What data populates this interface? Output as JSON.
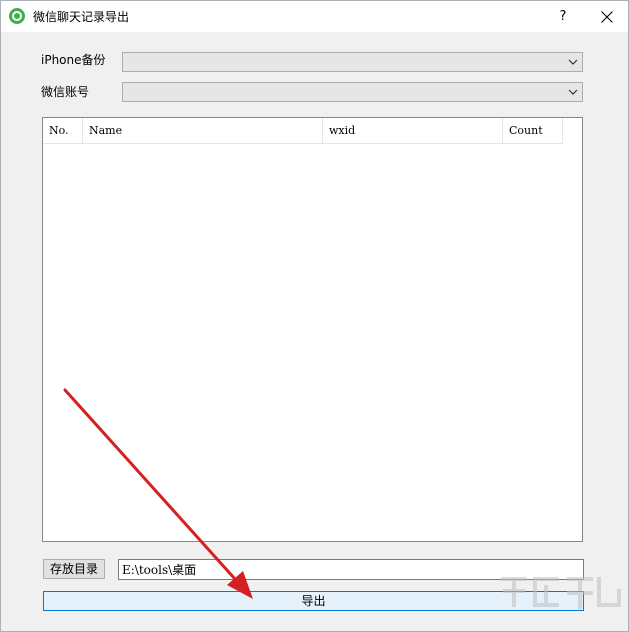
{
  "window": {
    "title": "微信聊天记录导出",
    "help_label": "?"
  },
  "form": {
    "iphone_backup_label": "iPhone备份",
    "iphone_backup_value": "",
    "wechat_account_label": "微信账号",
    "wechat_account_value": ""
  },
  "table": {
    "columns": [
      "No.",
      "Name",
      "wxid",
      "Count"
    ],
    "rows": []
  },
  "directory": {
    "button_label": "存放目录",
    "path_value": "E:\\tools\\桌面"
  },
  "export": {
    "button_label": "导出"
  },
  "colors": {
    "annotation_arrow": "#d42020",
    "accent_border": "#0078d7",
    "app_icon": "#3fb14c"
  },
  "icons": {
    "app": "wechat-icon",
    "close": "close-icon",
    "dropdown": "chevron-down-icon"
  }
}
